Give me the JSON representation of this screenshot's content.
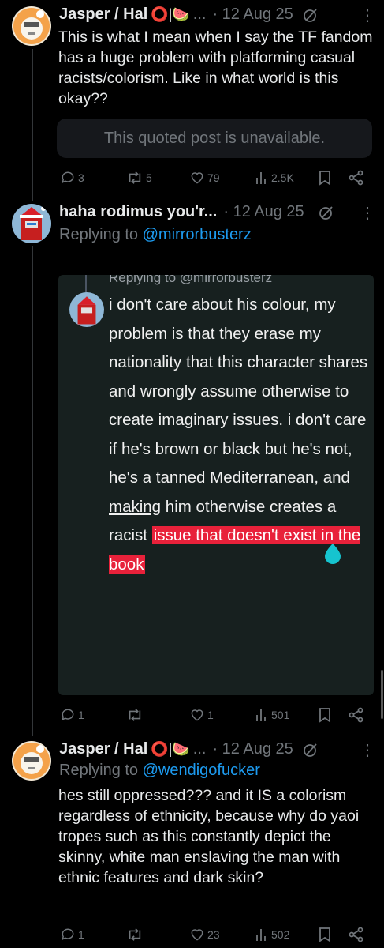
{
  "post1": {
    "author": "Jasper / Hal",
    "name_emojis": "⭕|🍉",
    "ellipsis": "...",
    "date": "· 12 Aug 25",
    "more": "⋮",
    "text": "This is what I mean when I say the TF fandom has a huge problem with platforming casual racists/colorism. Like in what world is this okay??",
    "quoted_unavailable": "This quoted post is unavailable.",
    "replies": "3",
    "reposts": "5",
    "likes": "79",
    "views": "2.5K"
  },
  "post2": {
    "author": "haha rodimus you'r...",
    "date": "· 12 Aug 25",
    "more": "⋮",
    "replying_prefix": "Replying to",
    "replying_handle": "@mirrorbusterz",
    "embed": {
      "replying_line": "Replying to @mirrorbusterz",
      "text_plain": "i don't care about his colour, my problem is that they erase my nationality that this character shares and wrongly assume otherwise to create imaginary issues. i don't care if he's brown or black but he's not, he's a tanned Mediterranean, and",
      "text_underlined": "making",
      "text_after": "him otherwise creates a racist",
      "text_highlighted": "issue that doesn't exist in the book"
    },
    "replies": "1",
    "reposts": "",
    "likes": "1",
    "views": "501"
  },
  "post3": {
    "author": "Jasper / Hal",
    "name_emojis": "⭕|🍉",
    "ellipsis": "...",
    "date": "· 12 Aug 25",
    "more": "⋮",
    "replying_prefix": "Replying to",
    "replying_handle": "@wendigofucker",
    "text": "hes still oppressed??? and it IS a colorism regardless of ethnicity, because why do yaoi tropes such as this constantly depict the skinny, white man enslaving the man with ethnic features and dark skin?",
    "replies": "1",
    "reposts": "",
    "likes": "23",
    "views": "502"
  },
  "colors": {
    "background": "#000000",
    "text": "#e7e9ea",
    "muted": "#71767b",
    "link": "#1d9bf0",
    "highlight": "#e8213a",
    "embed_bg": "#17201f"
  },
  "icons": [
    "reply-icon",
    "repost-icon",
    "like-icon",
    "views-icon",
    "bookmark-icon",
    "share-icon",
    "grok-icon",
    "more-icon"
  ]
}
